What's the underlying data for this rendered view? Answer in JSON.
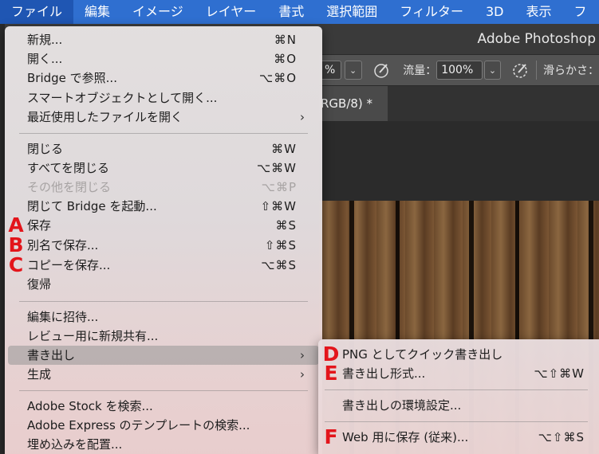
{
  "menubar": {
    "items": [
      "ファイル",
      "編集",
      "イメージ",
      "レイヤー",
      "書式",
      "選択範囲",
      "フィルター",
      "3D",
      "表示",
      "フ"
    ]
  },
  "app": {
    "title": "Adobe Photoshop",
    "options": {
      "opacity_value": "%",
      "flow_label": "流量：",
      "flow_value": "100%",
      "smoothing_label": "滑らかさ："
    },
    "doc_tab": "RGB/8) *"
  },
  "file_menu": {
    "items": [
      {
        "label": "新規...",
        "shortcut": "⌘N"
      },
      {
        "label": "開く...",
        "shortcut": "⌘O"
      },
      {
        "label": "Bridge で参照...",
        "shortcut": "⌥⌘O"
      },
      {
        "label": "スマートオブジェクトとして開く...",
        "shortcut": ""
      },
      {
        "label": "最近使用したファイルを開く",
        "shortcut": "",
        "submenu": "›"
      },
      {
        "label": "閉じる",
        "shortcut": "⌘W"
      },
      {
        "label": "すべてを閉じる",
        "shortcut": "⌥⌘W"
      },
      {
        "label": "その他を閉じる",
        "shortcut": "⌥⌘P",
        "disabled": true
      },
      {
        "label": "閉じて Bridge を起動...",
        "shortcut": "⇧⌘W"
      },
      {
        "label": "保存",
        "shortcut": "⌘S",
        "marker": "A"
      },
      {
        "label": "別名で保存...",
        "shortcut": "⇧⌘S",
        "marker": "B"
      },
      {
        "label": "コピーを保存...",
        "shortcut": "⌥⌘S",
        "marker": "C"
      },
      {
        "label": "復帰",
        "shortcut": ""
      },
      {
        "label": "編集に招待...",
        "shortcut": ""
      },
      {
        "label": "レビュー用に新規共有...",
        "shortcut": ""
      },
      {
        "label": "書き出し",
        "shortcut": "",
        "submenu": "›",
        "highlight": true
      },
      {
        "label": "生成",
        "shortcut": "",
        "submenu": "›"
      },
      {
        "label": "Adobe Stock を検索...",
        "shortcut": ""
      },
      {
        "label": "Adobe Express のテンプレートの検索...",
        "shortcut": ""
      },
      {
        "label": "埋め込みを配置...",
        "shortcut": ""
      }
    ]
  },
  "export_submenu": {
    "items": [
      {
        "label": "PNG としてクイック書き出し",
        "shortcut": "",
        "marker": "D"
      },
      {
        "label": "書き出し形式...",
        "shortcut": "⌥⇧⌘W",
        "marker": "E"
      },
      {
        "label": "書き出しの環境設定...",
        "shortcut": ""
      },
      {
        "label": "Web 用に保存 (従来)...",
        "shortcut": "⌥⇧⌘S",
        "marker": "F"
      }
    ]
  },
  "colors": {
    "menubar": "#2f6fd0",
    "marker": "#e3151b"
  }
}
